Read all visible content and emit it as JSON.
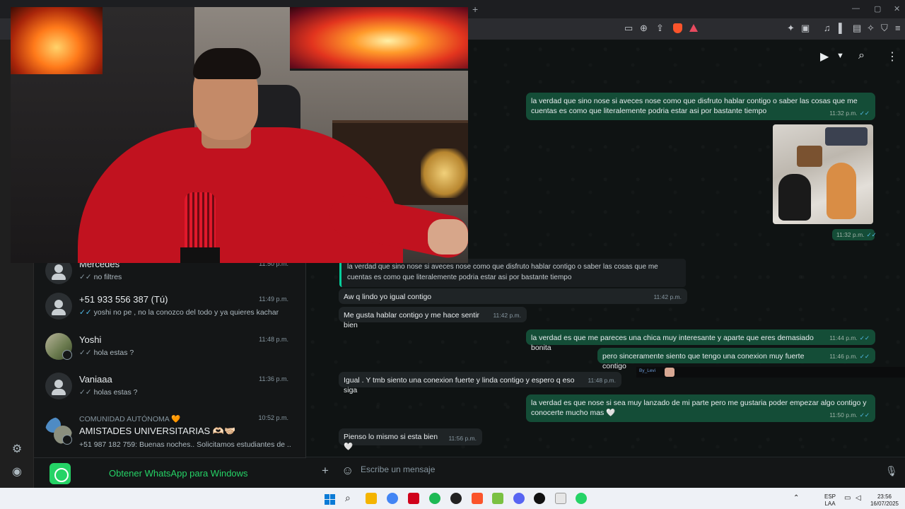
{
  "browser": {
    "new_tab": "+"
  },
  "chat_list": [
    {
      "name": "Mercedes",
      "time": "11:50 p.m.",
      "preview": "no filtres",
      "tick": "grey"
    },
    {
      "name": "+51 933 556 387 (Tú)",
      "time": "11:49 p.m.",
      "preview": "yoshi no pe , no la conozco del todo y ya quieres kachar",
      "tick": "blue"
    },
    {
      "name": "Yoshi",
      "time": "11:48 p.m.",
      "preview": "hola estas ?",
      "tick": "grey"
    },
    {
      "name": "Vaniaaa",
      "time": "11:36 p.m.",
      "preview": "holas estas ?",
      "tick": "grey"
    },
    {
      "community": "COMUNIDAD AUTÓNOMA 🧡",
      "name": "AMISTADES UNIVERSITARIAS 🫶🏻🫱🏼‍🫲🏻",
      "time": "10:52 p.m.",
      "preview": "+51 987 182 759: Buenas noches.. Solicitamos estudiantes de ..."
    }
  ],
  "download_banner": {
    "label": "Obtener WhatsApp para Windows"
  },
  "messages": {
    "m1": {
      "text": "la verdad que sino nose si aveces nose como que disfruto hablar contigo o saber las cosas que me cuentas es como que literalemente podria estar asi por bastante tiempo",
      "time": "11:32 p.m."
    },
    "m_img_time": "11:32 p.m.",
    "quote": "la verdad que sino nose si aveces nose como que disfruto hablar contigo o saber las cosas que me cuentas es como que literalemente podria estar asi por bastante tiempo",
    "m2": {
      "text": "Aw q lindo yo igual contigo",
      "time": "11:42 p.m."
    },
    "m3": {
      "text": "Me gusta hablar contigo y me hace sentir bien",
      "time": "11:42 p.m."
    },
    "m4": {
      "text": "la verdad es que me pareces una chica muy interesante y aparte que eres demasiado bonita",
      "time": "11:44 p.m."
    },
    "m5": {
      "text": "pero sinceramente siento que tengo una conexion muy fuerte contigo",
      "time": "11:46 p.m."
    },
    "m6": {
      "text": "Igual . Y tmb siento una conexion fuerte y linda contigo y espero q eso siga",
      "time": "11:48 p.m."
    },
    "m7": {
      "text": "la verdad es que nose si sea muy lanzado de mi parte pero me gustaria poder empezar algo contigo y conocerte mucho mas 🤍",
      "time": "11:50 p.m."
    },
    "m8": {
      "text": "Pienso lo mismo si esta bien 🤍",
      "time": "11:56 p.m."
    }
  },
  "overlay_tag": "By_Levi",
  "composer": {
    "placeholder": "Escribe un mensaje"
  },
  "taskbar": {
    "lang": "ESP",
    "layout": "LAA",
    "time": "23:56",
    "date": "16/07/2025"
  }
}
